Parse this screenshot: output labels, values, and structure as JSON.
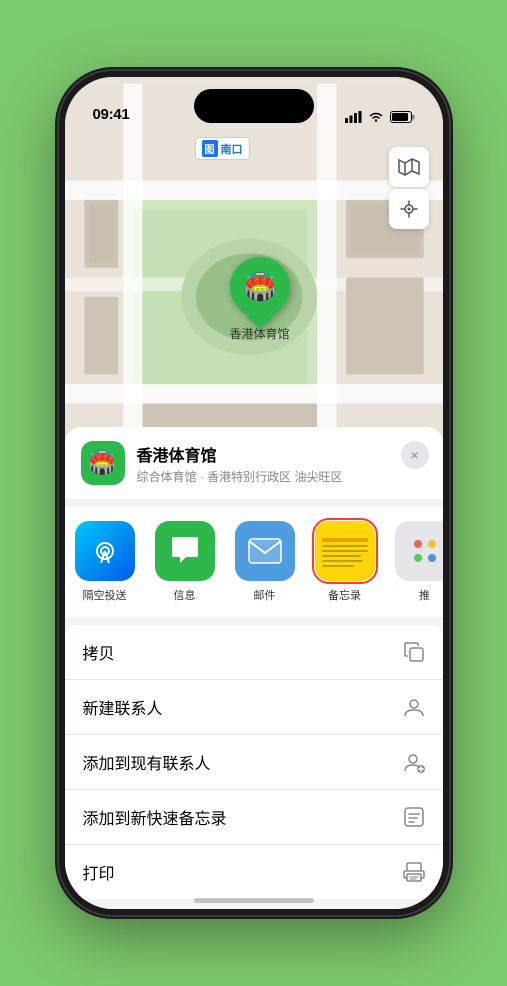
{
  "status_bar": {
    "time": "09:41",
    "signal_bars": "▂▄▆",
    "wifi": "WiFi",
    "battery": "Battery"
  },
  "map": {
    "label_icon": "图",
    "label_text": "南口"
  },
  "venue": {
    "name": "香港体育馆",
    "subtitle": "综合体育馆 · 香港特别行政区 油尖旺区",
    "marker_label": "香港体育馆",
    "icon": "🏟️"
  },
  "share_items": [
    {
      "id": "airdrop",
      "label": "隔空投送",
      "icon": "📡"
    },
    {
      "id": "messages",
      "label": "信息",
      "icon": "💬"
    },
    {
      "id": "mail",
      "label": "邮件",
      "icon": "✉️"
    },
    {
      "id": "notes",
      "label": "备忘录",
      "icon": "notes"
    },
    {
      "id": "more",
      "label": "推",
      "icon": "⋯"
    }
  ],
  "actions": [
    {
      "label": "拷贝",
      "icon": "copy"
    },
    {
      "label": "新建联系人",
      "icon": "person"
    },
    {
      "label": "添加到现有联系人",
      "icon": "person-add"
    },
    {
      "label": "添加到新快速备忘录",
      "icon": "note"
    },
    {
      "label": "打印",
      "icon": "print"
    }
  ],
  "close_button": "×"
}
